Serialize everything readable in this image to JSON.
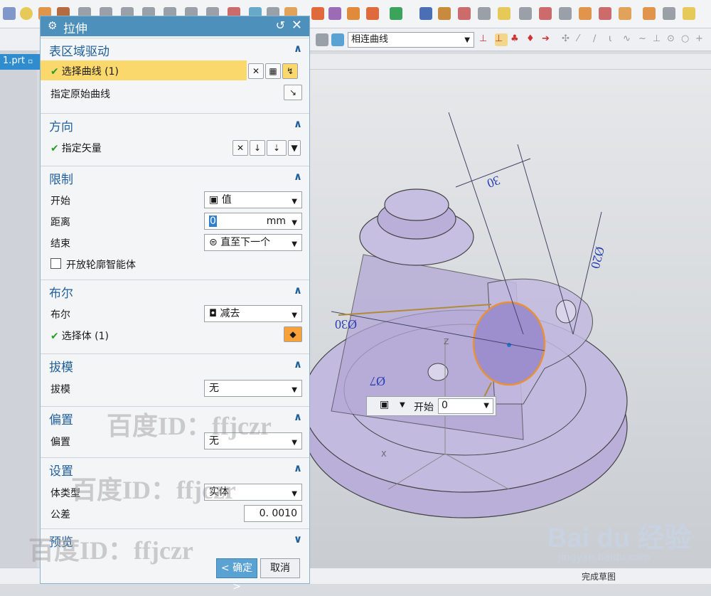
{
  "toolbar": {
    "curve_rule": "相连曲线"
  },
  "file_tab": {
    "label": "1.prt"
  },
  "dialog": {
    "title": "拉伸",
    "sections": {
      "surface": {
        "title": "表区域驱动",
        "select_curve": "选择曲线 (1)",
        "origin_curve": "指定原始曲线"
      },
      "direction": {
        "title": "方向",
        "vector": "指定矢量"
      },
      "limits": {
        "title": "限制",
        "start_label": "开始",
        "start_value": "值",
        "distance_label": "距离",
        "distance_value": "0",
        "distance_unit": "mm",
        "end_label": "结束",
        "end_value": "直至下一个",
        "open_profile": "开放轮廓智能体"
      },
      "boolean": {
        "title": "布尔",
        "label": "布尔",
        "value": "减去",
        "select_body": "选择体 (1)"
      },
      "draft": {
        "title": "拔模",
        "label": "拔模",
        "value": "无"
      },
      "offset": {
        "title": "偏置",
        "label": "偏置",
        "value": "无"
      },
      "settings": {
        "title": "设置",
        "body_type_label": "体类型",
        "body_type_value": "实体",
        "tolerance_label": "公差",
        "tolerance_value": "0. 0010"
      },
      "preview": {
        "title": "预览"
      }
    },
    "ok_label": "< 确定 >",
    "cancel_label": "取消"
  },
  "viewport": {
    "dims": {
      "d30_top": "30",
      "d20_right": "Ø20",
      "d30_left": "Ø30",
      "d7": "Ø7"
    },
    "float_start_label": "开始",
    "float_start_value": "0",
    "axis_x": "X",
    "axis_z": "Z"
  },
  "bottom": {
    "finish_sketch": "完成草图"
  },
  "watermarks": [
    "百度ID：ffjczr",
    "百度ID：ffjczr",
    "百度ID：ffjczr"
  ],
  "baidu": {
    "logo": "Bai du 经验",
    "url": "jingyan.baidu.com"
  },
  "colors": {
    "accent": "#4d90bc",
    "highlight": "#fbd86b",
    "body": "#b3a8d6",
    "edge": "#e8903a"
  }
}
